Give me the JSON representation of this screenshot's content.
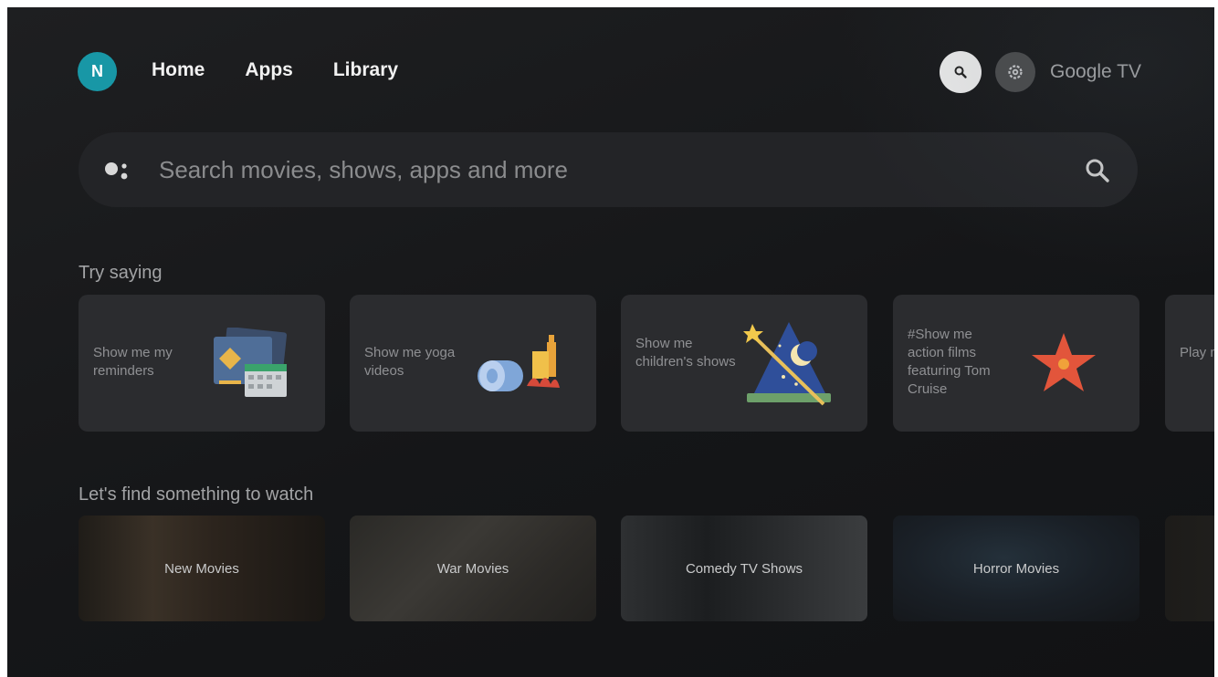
{
  "header": {
    "avatar_letter": "N",
    "nav": [
      "Home",
      "Apps",
      "Library"
    ],
    "brand": "Google TV"
  },
  "search": {
    "placeholder": "Search movies, shows, apps and more"
  },
  "try_saying": {
    "title": "Try saying",
    "cards": [
      {
        "text": "Show me my reminders",
        "icon": "calendar-icon"
      },
      {
        "text": "Show me yoga videos",
        "icon": "yoga-mat-icon"
      },
      {
        "text": "Show me children's shows",
        "icon": "wizard-hat-icon"
      },
      {
        "text": "#Show me action films featuring Tom Cruise",
        "icon": "star-icon"
      },
      {
        "text": "Play musi",
        "icon": ""
      }
    ]
  },
  "watch": {
    "title": "Let's find something to watch",
    "cards": [
      "New Movies",
      "War Movies",
      "Comedy TV Shows",
      "Horror Movies"
    ]
  },
  "colors": {
    "accent": "#1897a6",
    "background": "#151618",
    "card": "#2b2c2f"
  }
}
